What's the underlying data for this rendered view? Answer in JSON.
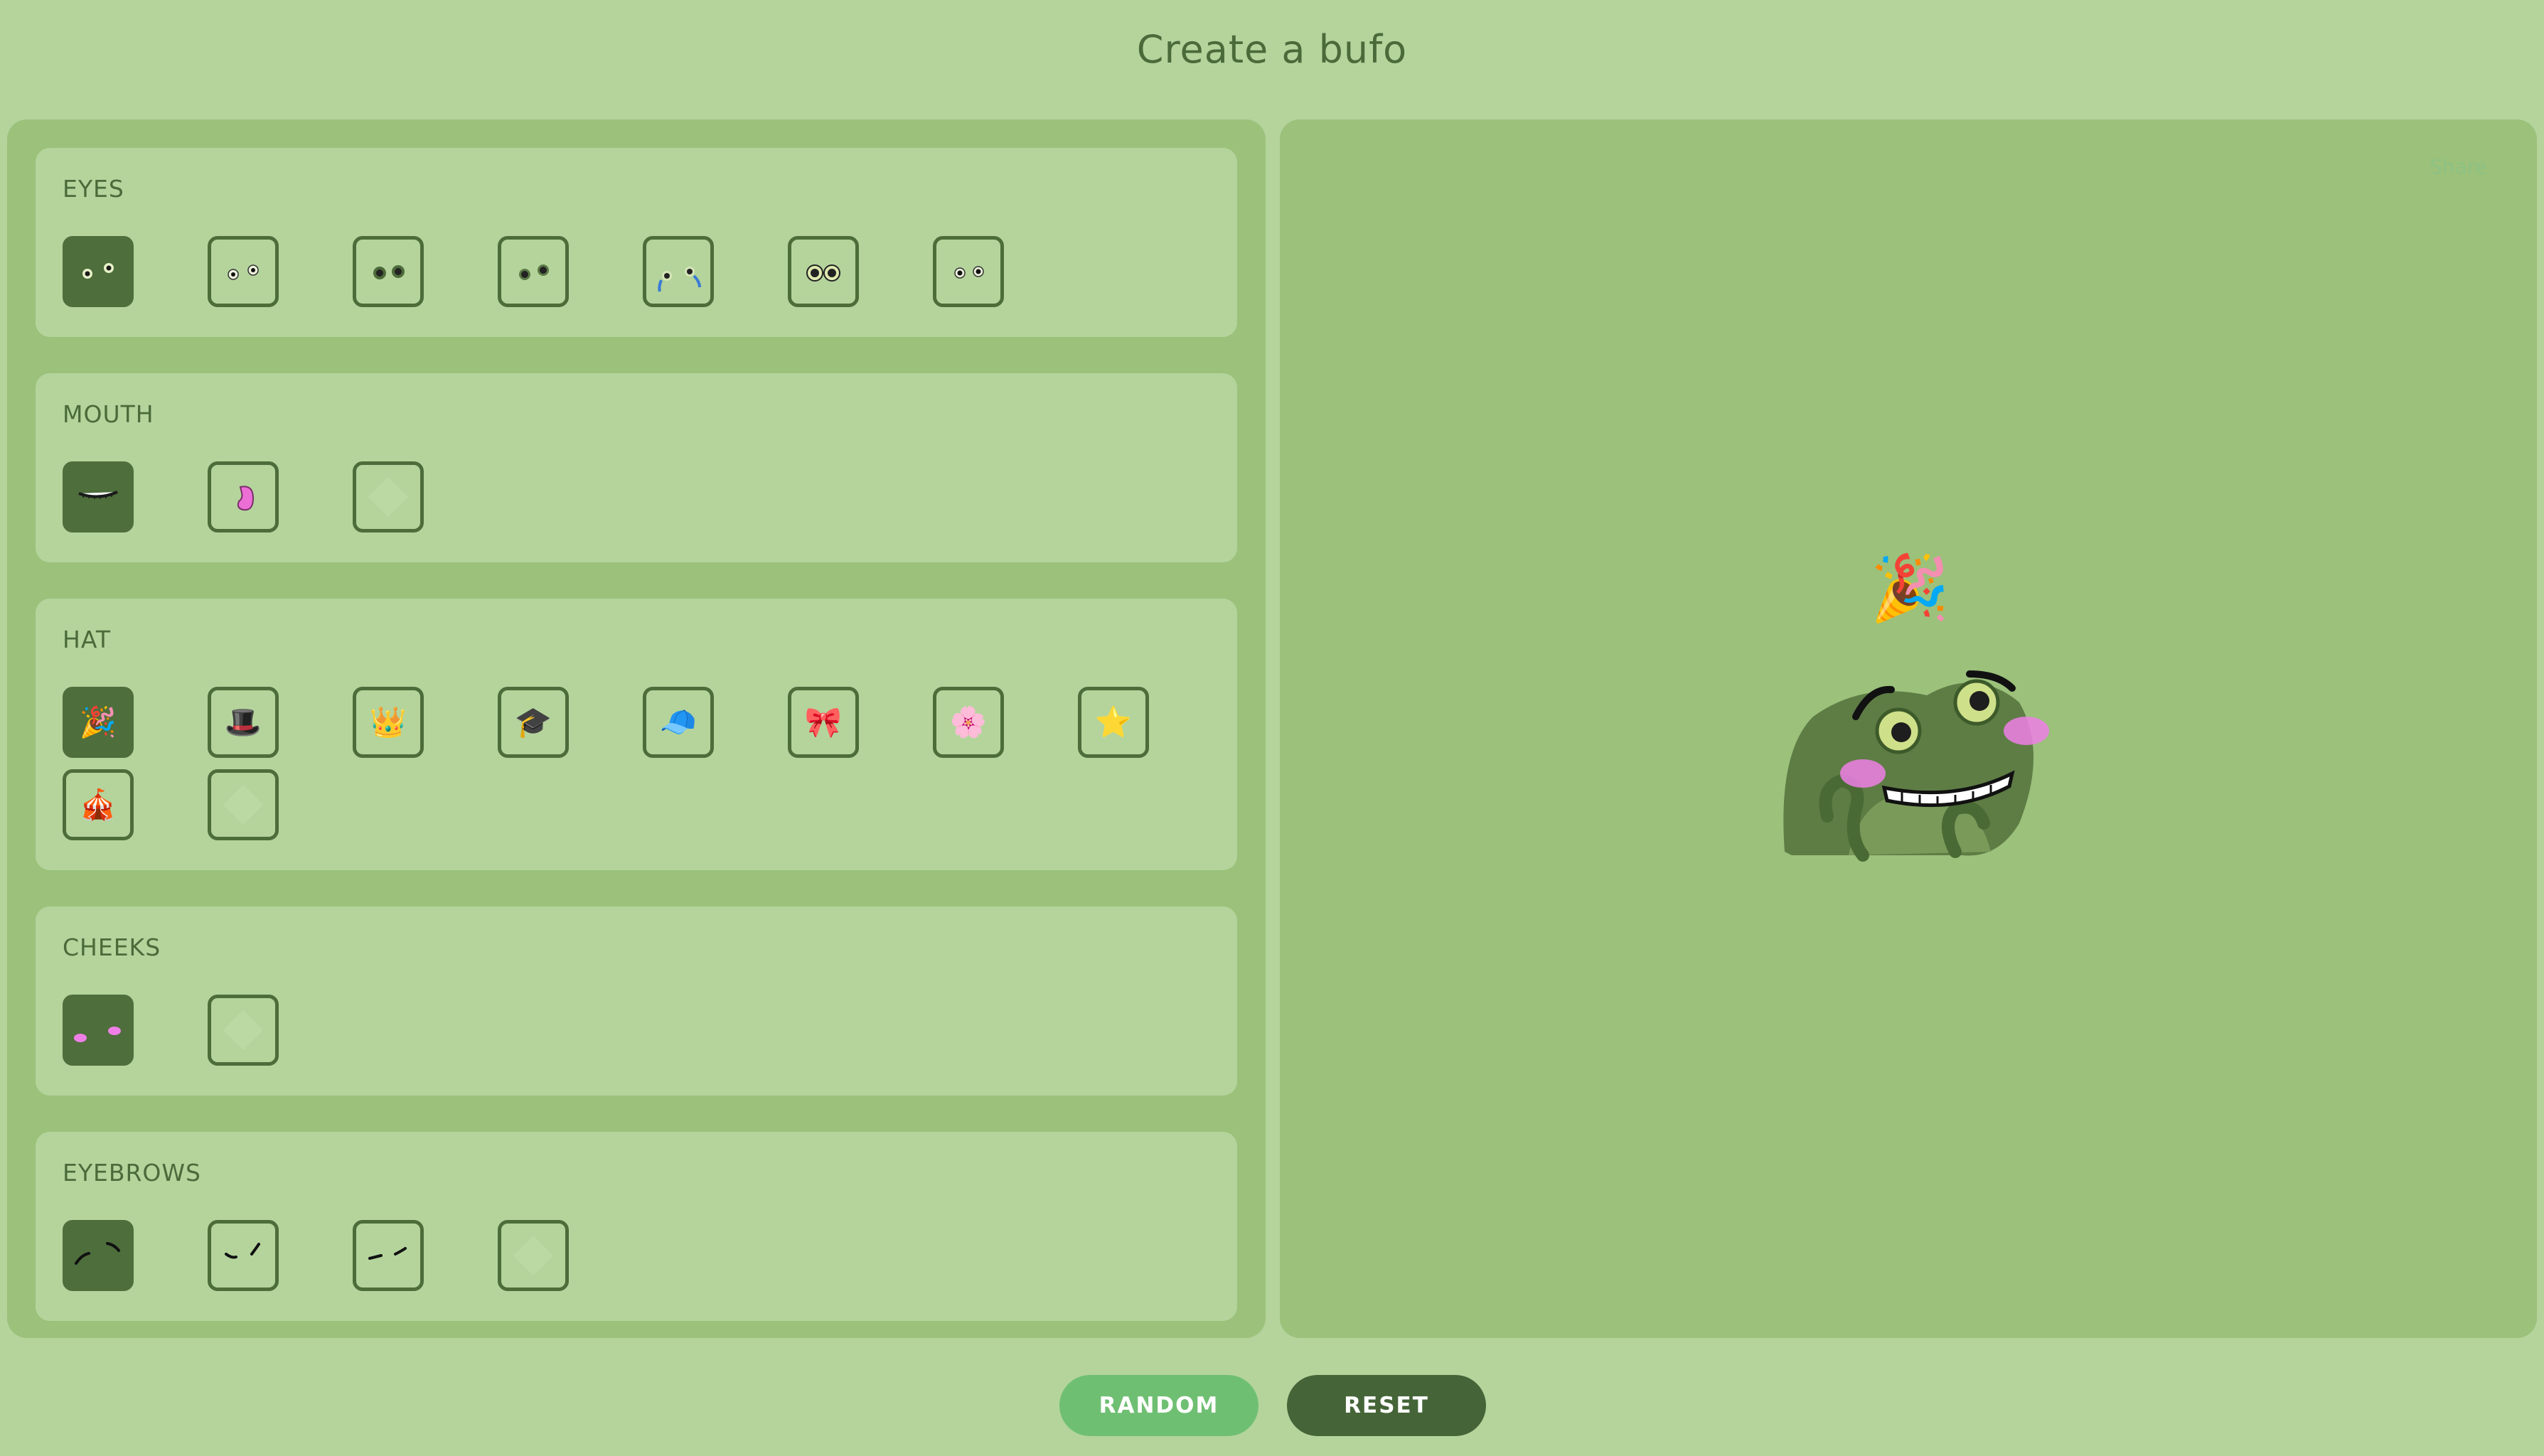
{
  "page": {
    "title": "Create a bufo"
  },
  "sections": {
    "eyes": {
      "label": "EYES",
      "options": [
        "eyes-1",
        "eyes-2",
        "eyes-3",
        "eyes-4",
        "eyes-5",
        "eyes-6",
        "eyes-7"
      ],
      "selected": 0
    },
    "mouth": {
      "label": "MOUTH",
      "options": [
        "mouth-grin",
        "mouth-tongue",
        "mouth-none"
      ],
      "selected": 0
    },
    "hat": {
      "label": "HAT",
      "options": [
        "party-popper",
        "top-hat",
        "crown",
        "graduation-cap",
        "baseball-cap",
        "bow",
        "flower",
        "star",
        "circus-tent",
        "none"
      ],
      "selected": 0
    },
    "cheeks": {
      "label": "CHEEKS",
      "options": [
        "blush",
        "none"
      ],
      "selected": 0
    },
    "eyebrows": {
      "label": "EYEBROWS",
      "options": [
        "brows-worried",
        "brows-raised",
        "brows-flat",
        "none"
      ],
      "selected": 0
    }
  },
  "preview": {
    "share_label": "Share"
  },
  "buttons": {
    "random": "RANDOM",
    "reset": "RESET"
  },
  "colors": {
    "background": "#b4d49c",
    "panel": "#9bc17b",
    "accent_dark": "#456538",
    "accent_green": "#6fbf73",
    "frog_green": "#56733f",
    "blush": "#e884e0"
  }
}
